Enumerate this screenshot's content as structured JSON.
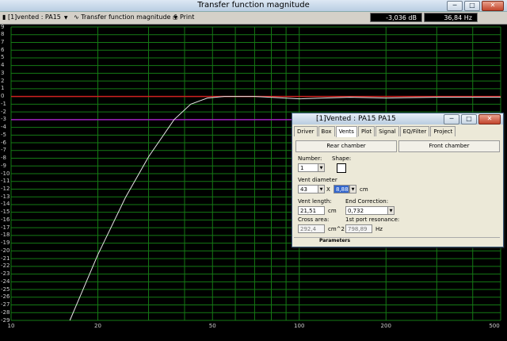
{
  "window": {
    "title": "Transfer function magnitude"
  },
  "toolbar": {
    "project_select": "[1]vented : PA15",
    "view_select": "Transfer function magnitude",
    "print_label": "Print",
    "readout_db": "-3,036 dB",
    "readout_hz": "36,84 Hz"
  },
  "plot": {
    "y_ticks": [
      "9",
      "8",
      "7",
      "6",
      "5",
      "4",
      "3",
      "2",
      "1",
      "0",
      "-1",
      "-2",
      "-3",
      "-4",
      "-5",
      "-6",
      "-7",
      "-8",
      "-9",
      "-10",
      "-11",
      "-12",
      "-13",
      "-14",
      "-15",
      "-16",
      "-17",
      "-18",
      "-19",
      "-20",
      "-21",
      "-22",
      "-23",
      "-24",
      "-25",
      "-26",
      "-27",
      "-28",
      "-29"
    ],
    "x_ticks": [
      "10",
      "20",
      "50",
      "100",
      "200",
      "500"
    ],
    "colors": {
      "grid": "#157a15",
      "zero_line": "#d02020",
      "minus3_line": "#a020c0",
      "curve": "#e6e6e6"
    }
  },
  "chart_data": {
    "type": "line",
    "xlabel": "",
    "ylabel": "",
    "xscale": "log",
    "xlim": [
      10,
      500
    ],
    "ylim": [
      -29,
      9
    ],
    "grid": true,
    "series": [
      {
        "x": [
          16,
          20,
          25,
          30,
          36.8,
          42,
          48,
          55,
          70,
          100,
          150,
          200,
          300,
          500
        ],
        "y": [
          -29,
          -20.5,
          -13,
          -7.8,
          -3.0,
          -1.0,
          -0.2,
          0,
          0,
          -0.3,
          -0.1,
          -0.2,
          -0.1,
          -0.1
        ]
      }
    ],
    "reference_lines": [
      {
        "y": 0,
        "color": "#d02020"
      },
      {
        "y": -3,
        "color": "#a020c0"
      }
    ]
  },
  "dialog": {
    "title": "[1]Vented : PA15  PA15",
    "tabs": [
      "Driver",
      "Box",
      "Vents",
      "Plot",
      "Signal",
      "EQ/Filter",
      "Project"
    ],
    "rear_chamber": "Rear chamber",
    "front_chamber": "Front chamber",
    "number_label": "Number:",
    "number_value": "1",
    "shape_label": "Shape:",
    "vent_diameter_label": "Vent diameter",
    "vent_diameter_value": "43",
    "times_sign": "X",
    "vent_diameter_value2": "8,88",
    "cm_unit": "cm",
    "vent_length_label": "Vent length:",
    "vent_length_value": "21,51",
    "end_correction_label": "End Correction:",
    "end_correction_value": "0,732",
    "cross_area_label": "Cross area:",
    "cross_area_value": "292,4",
    "cross_area_unit": "cm^2",
    "port_resonance_label": "1st port resonance:",
    "port_resonance_value": "798,89",
    "hz_unit": "Hz",
    "status": "Parameters"
  }
}
